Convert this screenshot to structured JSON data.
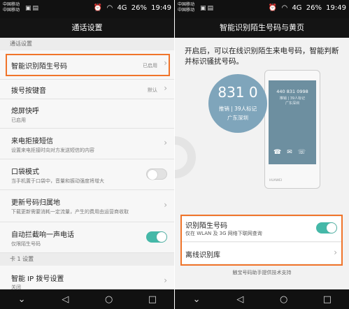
{
  "status": {
    "carrier_line1": "中国移动",
    "carrier_line2": "中国移动",
    "signal_label": "4G",
    "battery": "26%",
    "time": "19:49"
  },
  "left": {
    "title": "通话设置",
    "section1": "通话设置",
    "rows": [
      {
        "title": "智能识别陌生号码",
        "value": "已启用"
      },
      {
        "title": "拨号按键音",
        "value": "默认"
      },
      {
        "title": "熄屏快呼",
        "sub": "已启用"
      },
      {
        "title": "来电拒接短信",
        "sub": "设置来电拒接时向对方发送短信的内容"
      },
      {
        "title": "口袋模式",
        "sub": "当手机置于口袋中，音量和振动强度将增大",
        "toggle": "off"
      },
      {
        "title": "更新号码归属地",
        "sub": "下载更新需要消耗一定流量，产生的费用由运营商收取"
      },
      {
        "title": "自动拦截响一声电话",
        "sub": "仅限陌生号码",
        "toggle": "on"
      }
    ],
    "section2": "卡 1 设置",
    "last_row": {
      "title": "智能 IP 拨号设置",
      "sub": "关闭"
    }
  },
  "right": {
    "title": "智能识别陌生号码与黄页",
    "intro": "开启后，可以在线识别陌生来电号码，智能判断并标识骚扰号码。",
    "bubble": {
      "number": "831 0",
      "tag": "推销 | 39人标记",
      "location": "广东深圳"
    },
    "phone": {
      "number": "440 831 0998",
      "tag": "推销 | 39人标记",
      "location": "广东深圳",
      "brand": "HUAWEI"
    },
    "option1": {
      "title": "识别陌生号码",
      "sub": "仅在 WLAN 及 3G 网络下联网查询",
      "toggle": "on"
    },
    "option2": {
      "title": "离线识别库"
    },
    "footer": "触宝号码助手提供技术支持"
  },
  "nav": {
    "back": "◁",
    "home": "○",
    "recent": "□",
    "down": "⌄"
  },
  "colors": {
    "accent": "#45b8a8",
    "highlight": "#f0742a",
    "bar": "#111111"
  }
}
